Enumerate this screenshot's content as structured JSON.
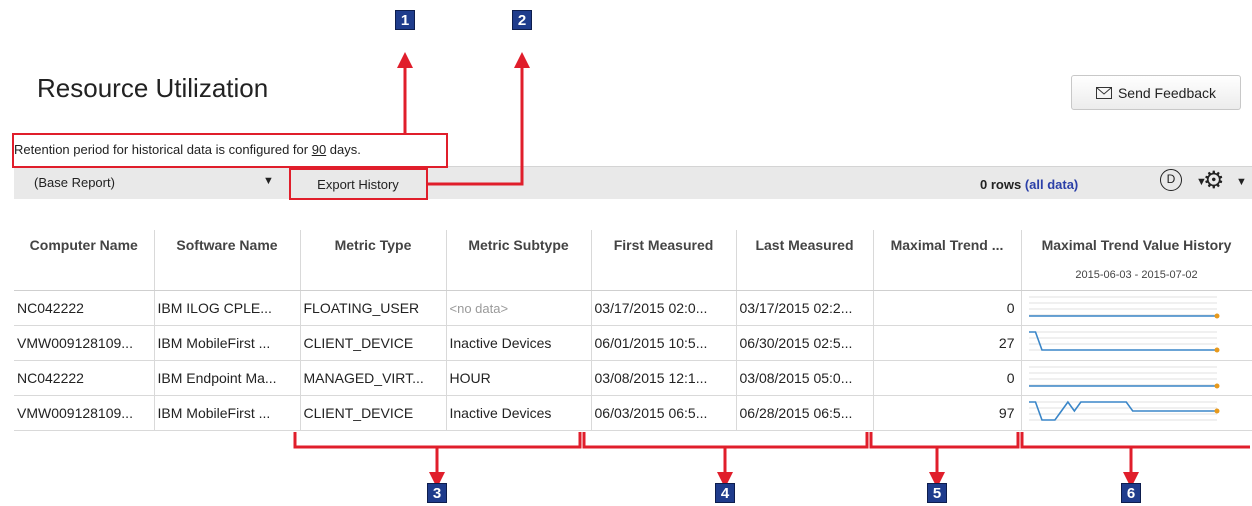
{
  "page": {
    "title": "Resource Utilization"
  },
  "feedback": {
    "label": "Send Feedback",
    "icon": "envelope-icon"
  },
  "retention": {
    "prefix": "Retention period for historical data is configured for ",
    "days": "90",
    "suffix": " days."
  },
  "toolbar": {
    "report_select": "(Base Report)",
    "export_label": "Export History",
    "rows_count": "0 rows",
    "all_data_link": "(all data)",
    "d_icon_label": "D"
  },
  "table": {
    "columns": [
      "Computer Name",
      "Software Name",
      "Metric Type",
      "Metric Subtype",
      "First Measured",
      "Last Measured",
      "Maximal Trend ...",
      "Maximal Trend Value History"
    ],
    "history_range": "2015-06-03 - 2015-07-02",
    "rows": [
      {
        "computer": "NC042222",
        "software": "IBM ILOG CPLE...",
        "metric": "FLOATING_USER",
        "subtype": "<no data>",
        "first": "03/17/2015 02:0...",
        "last": "03/17/2015 02:2...",
        "trend": "0",
        "spark": [
          0,
          0,
          0,
          0,
          0,
          0,
          0,
          0,
          0,
          0,
          0,
          0,
          0,
          0,
          0,
          0,
          0,
          0,
          0,
          0,
          0,
          0,
          0,
          0,
          0,
          0,
          0,
          0,
          0,
          0
        ]
      },
      {
        "computer": "VMW009128109...",
        "software": "IBM MobileFirst ...",
        "metric": "CLIENT_DEVICE",
        "subtype": "Inactive Devices",
        "first": "06/01/2015 10:5...",
        "last": "06/30/2015 02:5...",
        "trend": "27",
        "spark": [
          27,
          27,
          26,
          26,
          26,
          26,
          26,
          26,
          26,
          26,
          26,
          26,
          26,
          26,
          26,
          26,
          26,
          26,
          26,
          26,
          26,
          26,
          26,
          26,
          26,
          26,
          26,
          26,
          26,
          26
        ]
      },
      {
        "computer": "NC042222",
        "software": "IBM Endpoint Ma...",
        "metric": "MANAGED_VIRT...",
        "subtype": "HOUR",
        "first": "03/08/2015 12:1...",
        "last": "03/08/2015 05:0...",
        "trend": "0",
        "spark": [
          0,
          0,
          0,
          0,
          0,
          0,
          0,
          0,
          0,
          0,
          0,
          0,
          0,
          0,
          0,
          0,
          0,
          0,
          0,
          0,
          0,
          0,
          0,
          0,
          0,
          0,
          0,
          0,
          0,
          0
        ]
      },
      {
        "computer": "VMW009128109...",
        "software": "IBM MobileFirst ...",
        "metric": "CLIENT_DEVICE",
        "subtype": "Inactive Devices",
        "first": "06/03/2015 06:5...",
        "last": "06/28/2015 06:5...",
        "trend": "97",
        "spark": [
          97,
          97,
          95,
          95,
          95,
          96,
          97,
          96,
          97,
          97,
          97,
          97,
          97,
          97,
          97,
          97,
          96,
          96,
          96,
          96,
          96,
          96,
          96,
          96,
          96,
          96,
          96,
          96,
          96,
          96
        ]
      }
    ]
  },
  "callouts": [
    "1",
    "2",
    "3",
    "4",
    "5",
    "6"
  ],
  "colors": {
    "accent": "#1f3c8c",
    "highlight": "#e01e2b",
    "spark": "#3a86c8",
    "spark_end": "#e89a1c"
  }
}
